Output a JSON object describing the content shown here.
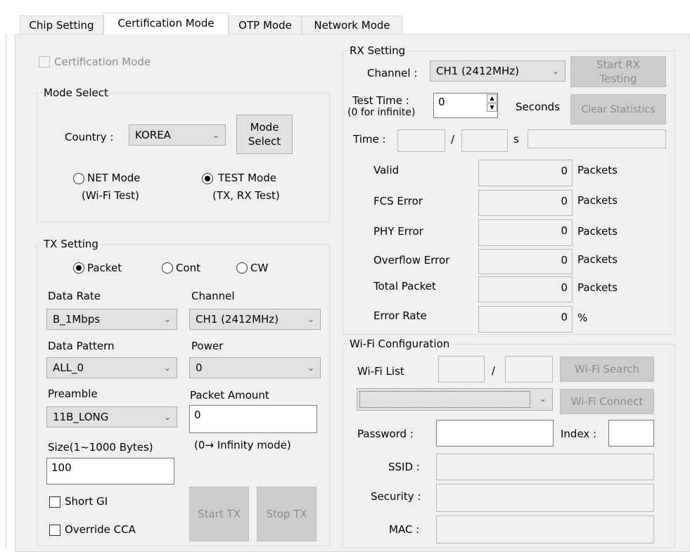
{
  "tabs": [
    "Chip Setting",
    "Certification Mode",
    "OTP Mode",
    "Network Mode"
  ],
  "certification_checkbox": "Certification Mode",
  "mode_select": {
    "title": "Mode Select",
    "country_label": "Country :",
    "country_value": "KOREA",
    "button": "Mode\nSelect",
    "net_mode": "NET Mode",
    "net_sub": "(Wi-Fi Test)",
    "test_mode": "TEST Mode",
    "test_sub": "(TX, RX Test)",
    "selected": "TEST Mode"
  },
  "tx": {
    "title": "TX Setting",
    "radio_packet": "Packet",
    "radio_cont": "Cont",
    "radio_cw": "CW",
    "selected": "Packet",
    "data_rate_label": "Data Rate",
    "data_rate_value": "B_1Mbps",
    "channel_label": "Channel",
    "channel_value": "CH1 (2412MHz)",
    "pattern_label": "Data Pattern",
    "pattern_value": "ALL_0",
    "power_label": "Power",
    "power_value": "0",
    "preamble_label": "Preamble",
    "preamble_value": "11B_LONG",
    "amount_label": "Packet Amount",
    "amount_value": "0",
    "amount_hint": "(0→ Infinity mode)",
    "size_label": "Size(1~1000 Bytes)",
    "size_value": "100",
    "short_gi": "Short GI",
    "override_cca": "Override CCA",
    "start": "Start TX",
    "stop": "Stop TX"
  },
  "rx": {
    "title": "RX Setting",
    "channel_label": "Channel :",
    "channel_value": "CH1 (2412MHz)",
    "start_button": "Start RX\nTesting",
    "test_time_label": "Test Time :",
    "test_time_hint": "(0 for infinite)",
    "test_time_value": "0",
    "seconds": "Seconds",
    "clear_button": "Clear Statistics",
    "time_label": "Time :",
    "slash": "/",
    "s_label": "s",
    "stats": [
      {
        "label": "Valid",
        "value": "0",
        "unit": "Packets"
      },
      {
        "label": "FCS Error",
        "value": "0",
        "unit": "Packets"
      },
      {
        "label": "PHY Error",
        "value": "0",
        "unit": "Packets"
      },
      {
        "label": "Overflow Error",
        "value": "0",
        "unit": "Packets"
      },
      {
        "label": "Total Packet",
        "value": "0",
        "unit": "Packets"
      },
      {
        "label": "Error Rate",
        "value": "0",
        "unit": "%"
      }
    ]
  },
  "wifi": {
    "title": "Wi-Fi Configuration",
    "list_label": "Wi-Fi List",
    "slash": "/",
    "search_button": "Wi-Fi Search",
    "connect_button": "Wi-Fi Connect",
    "password_label": "Password :",
    "index_label": "Index :",
    "ssid_label": "SSID :",
    "security_label": "Security :",
    "mac_label": "MAC :"
  }
}
